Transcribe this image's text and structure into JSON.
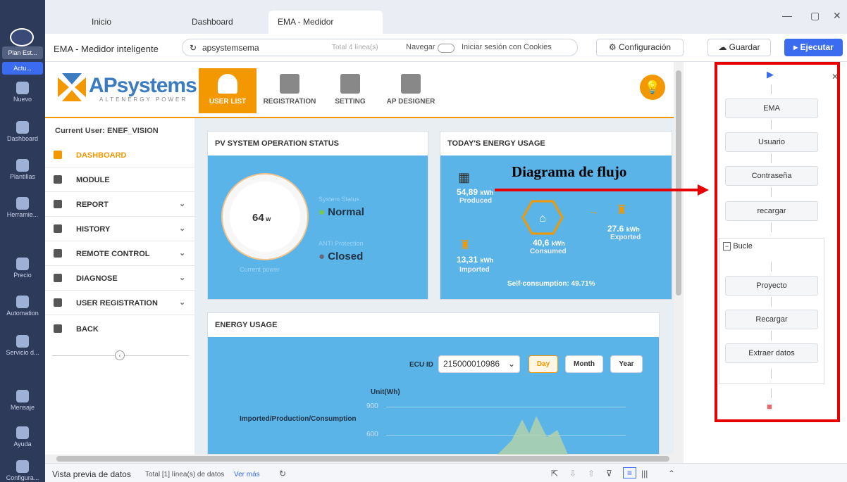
{
  "rail": {
    "plan": "Plan Est...",
    "actu": "Actu...",
    "items": [
      {
        "label": "Nuevo",
        "icon": "plus-icon"
      },
      {
        "label": "Dashboard",
        "icon": "dashboard-icon"
      },
      {
        "label": "Plantillas",
        "icon": "templates-icon"
      },
      {
        "label": "Herramie...",
        "icon": "tools-icon"
      },
      {
        "label": "Precio",
        "icon": "price-icon"
      },
      {
        "label": "Automation",
        "icon": "automation-icon"
      },
      {
        "label": "Servicio d...",
        "icon": "service-icon"
      },
      {
        "label": "Mensaje",
        "icon": "bell-icon"
      },
      {
        "label": "Ayuda",
        "icon": "help-icon"
      },
      {
        "label": "Configura...",
        "icon": "gear-icon"
      }
    ]
  },
  "tabs": [
    "Inicio",
    "Dashboard",
    "EMA - Medidor intelige..."
  ],
  "app_title": "EMA - Medidor inteligente",
  "url": "apsystemsema",
  "url_info": "Total 4 línea(s)",
  "navegar": "Navegar",
  "cookies": "Iniciar sesión con Cookies",
  "config_btn": "Configuración",
  "save_btn": "Guardar",
  "run_btn": "Ejecutar",
  "site": {
    "logo": "APsystems",
    "logo_sub": "ALTENERGY POWER",
    "nav": [
      "USER LIST",
      "REGISTRATION",
      "SETTING",
      "AP DESIGNER"
    ],
    "current_user": "Current User: ENEF_VISION",
    "menu": [
      "DASHBOARD",
      "MODULE",
      "REPORT",
      "HISTORY",
      "REMOTE CONTROL",
      "DIAGNOSE",
      "USER REGISTRATION",
      "BACK"
    ],
    "pv_title": "PV SYSTEM OPERATION STATUS",
    "power": "64",
    "power_unit": "w",
    "current_power": "Current power",
    "system_status_label": "System Status",
    "system_status": "Normal",
    "anti_label": "ANTI Protection",
    "anti": "Closed",
    "energy_title": "TODAY'S ENERGY USAGE",
    "produced": "54,89",
    "produced_unit": "kWh",
    "produced_label": "Produced",
    "imported": "13,31",
    "imported_unit": "kWh",
    "imported_label": "Imported",
    "consumed": "40,6",
    "consumed_unit": "kWh",
    "consumed_label": "Consumed",
    "exported": "27.6",
    "exported_unit": "kWh",
    "exported_label": "Exported",
    "self": "Self-consumption: 49.71%",
    "usage_title": "ENERGY USAGE",
    "ecu_label": "ECU ID",
    "ecu_value": "215000010986",
    "periods": [
      "Day",
      "Month",
      "Year"
    ],
    "unit": "Unit(Wh)",
    "y900": "900",
    "y600": "600",
    "legend": "Imported/Production/Consumption"
  },
  "annotation": "Diagrama de flujo",
  "flow": [
    "EMA",
    "Usuario",
    "Contraseña",
    "recargar",
    "Bucle",
    "Proyecto",
    "Recargar",
    "Extraer datos"
  ],
  "bottom": {
    "label": "Vista previa de datos",
    "info": "Total [1] línea(s) de datos",
    "more": "Ver más"
  }
}
